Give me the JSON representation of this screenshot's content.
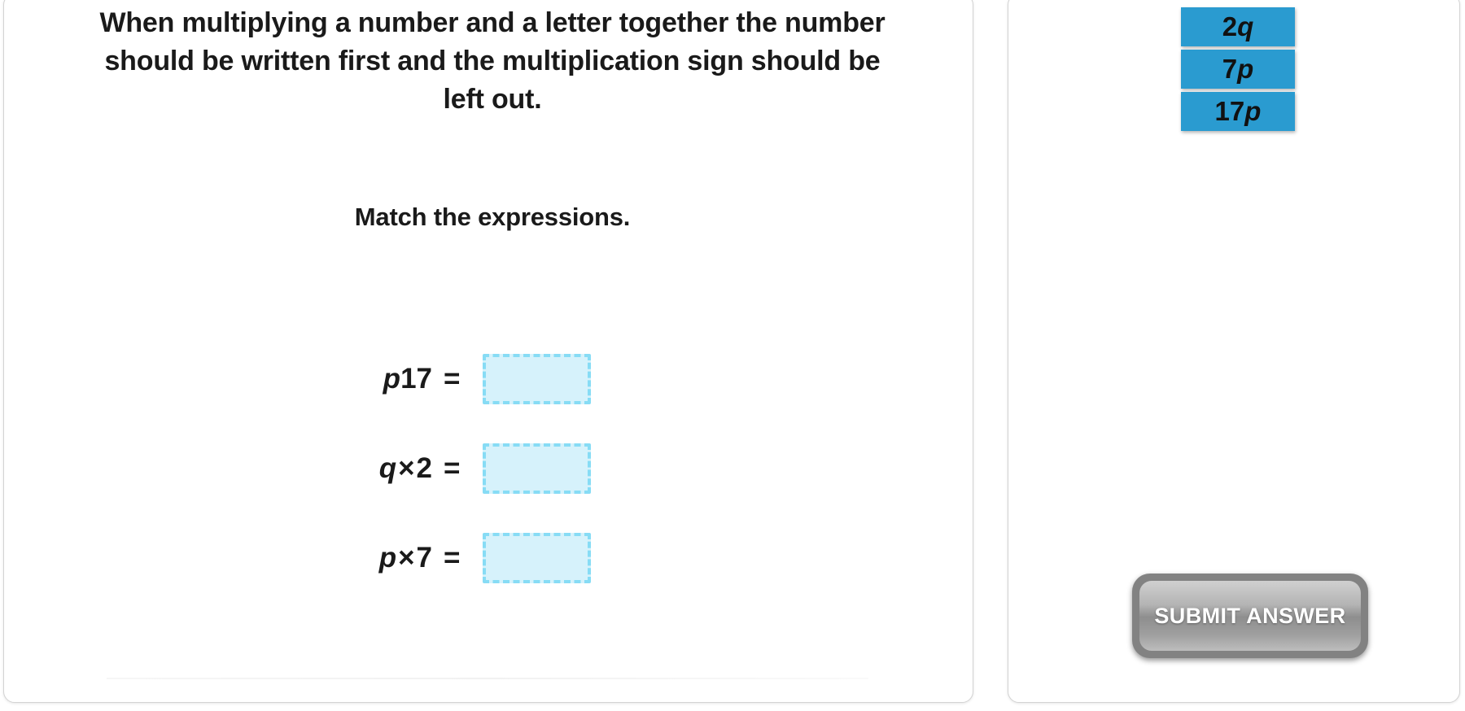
{
  "question_panel": {
    "instruction": "When multiplying a number and a letter together the number should be written first and the multiplication sign should be left out.",
    "match_prompt": "Match the expressions.",
    "expressions": [
      {
        "id": "row-1",
        "full_text": "p17",
        "variable": "p",
        "operator": "",
        "number": "17",
        "equals": "=",
        "dropzone_value": "",
        "dropzone_placeholder": ""
      },
      {
        "id": "row-2",
        "full_text": "q × 2",
        "variable": "q",
        "operator": "×",
        "number": "2",
        "equals": "=",
        "dropzone_value": "",
        "dropzone_placeholder": ""
      },
      {
        "id": "row-3",
        "full_text": "p × 7",
        "variable": "p",
        "operator": "×",
        "number": "7",
        "equals": "=",
        "dropzone_value": "",
        "dropzone_placeholder": ""
      }
    ]
  },
  "answer_panel": {
    "tiles": [
      {
        "id": "tile-2q",
        "number": "2",
        "variable": "q",
        "full_text": "2q"
      },
      {
        "id": "tile-7p",
        "number": "7",
        "variable": "p",
        "full_text": "7p"
      },
      {
        "id": "tile-17p",
        "number": "17",
        "variable": "p",
        "full_text": "17p"
      }
    ],
    "submit_label": "SUBMIT ANSWER"
  },
  "colors": {
    "tile_blue": "#2a9bd0",
    "dropzone_fill": "#d6f2fb",
    "dropzone_border": "#87dcf5",
    "panel_border": "#d3d3d3",
    "text": "#1a1a1a",
    "submit_bevel": "#828282",
    "submit_label": "#ffffff",
    "background": "#ffffff"
  }
}
